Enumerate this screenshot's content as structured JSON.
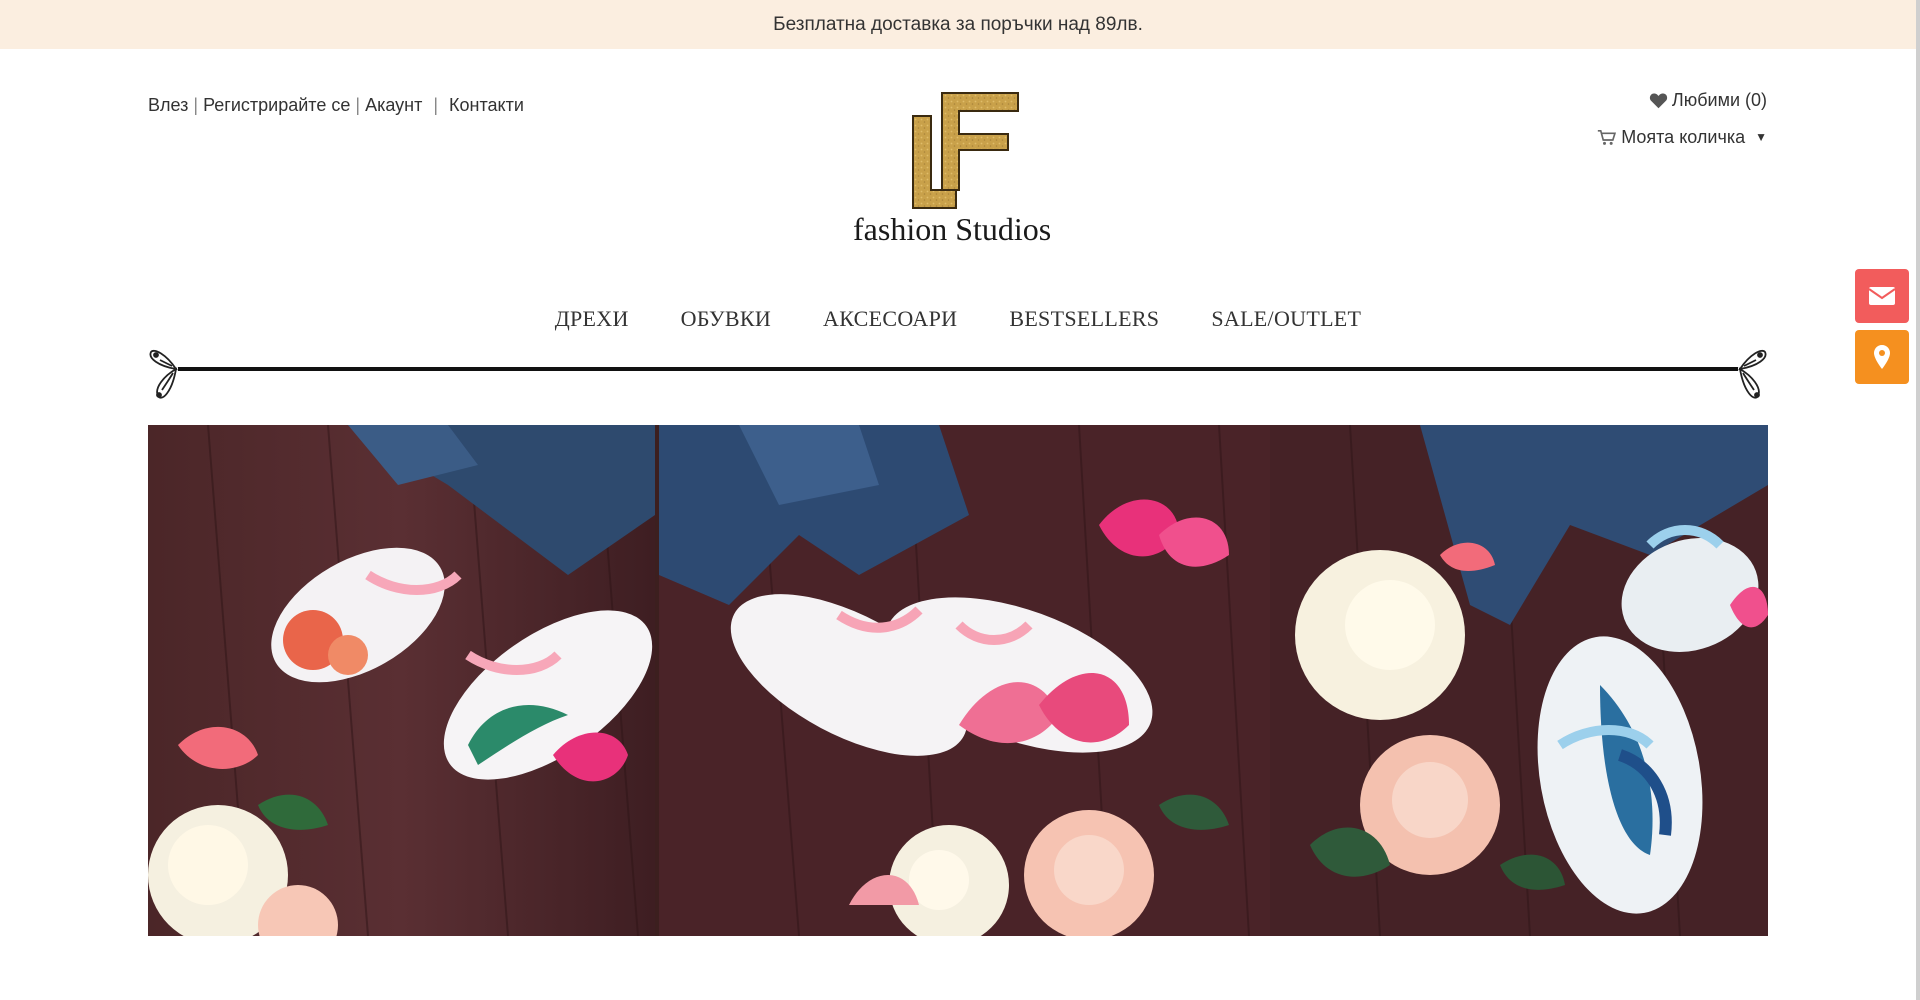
{
  "promo": {
    "text": "Безплатна доставка за поръчки над 89лв."
  },
  "account": {
    "login": "Влез",
    "register": "Регистрирайте се",
    "account": "Акаунт",
    "contacts": "Контакти",
    "sep": "|"
  },
  "brand": {
    "name": "fashion Studios",
    "monogram_left": "L",
    "monogram_right": "F",
    "gold": "#c9a14a"
  },
  "tools": {
    "wishlist": "Любими (0)",
    "cart": "Моята количка",
    "cart_caret": "▼",
    "icons": {
      "wishlist": "heart-icon",
      "cart": "cart-icon"
    }
  },
  "nav": {
    "items": [
      "ДРЕХИ",
      "ОБУВКИ",
      "АКСЕСОАРИ",
      "BESTSELLERS",
      "SALE/OUTLET"
    ]
  },
  "side_buttons": {
    "email_icon": "envelope-icon",
    "location_icon": "map-marker-icon",
    "email_color": "#f25c5c",
    "location_color": "#f5901f"
  },
  "hero": {
    "panels": [
      "white sneakers with pink ribbon laces, painted roses and a hummingbird",
      "white sneakers with pink ribbon laces and painted pink butterflies",
      "white sneakers with blue ribbon laces and a painted peacock"
    ]
  }
}
